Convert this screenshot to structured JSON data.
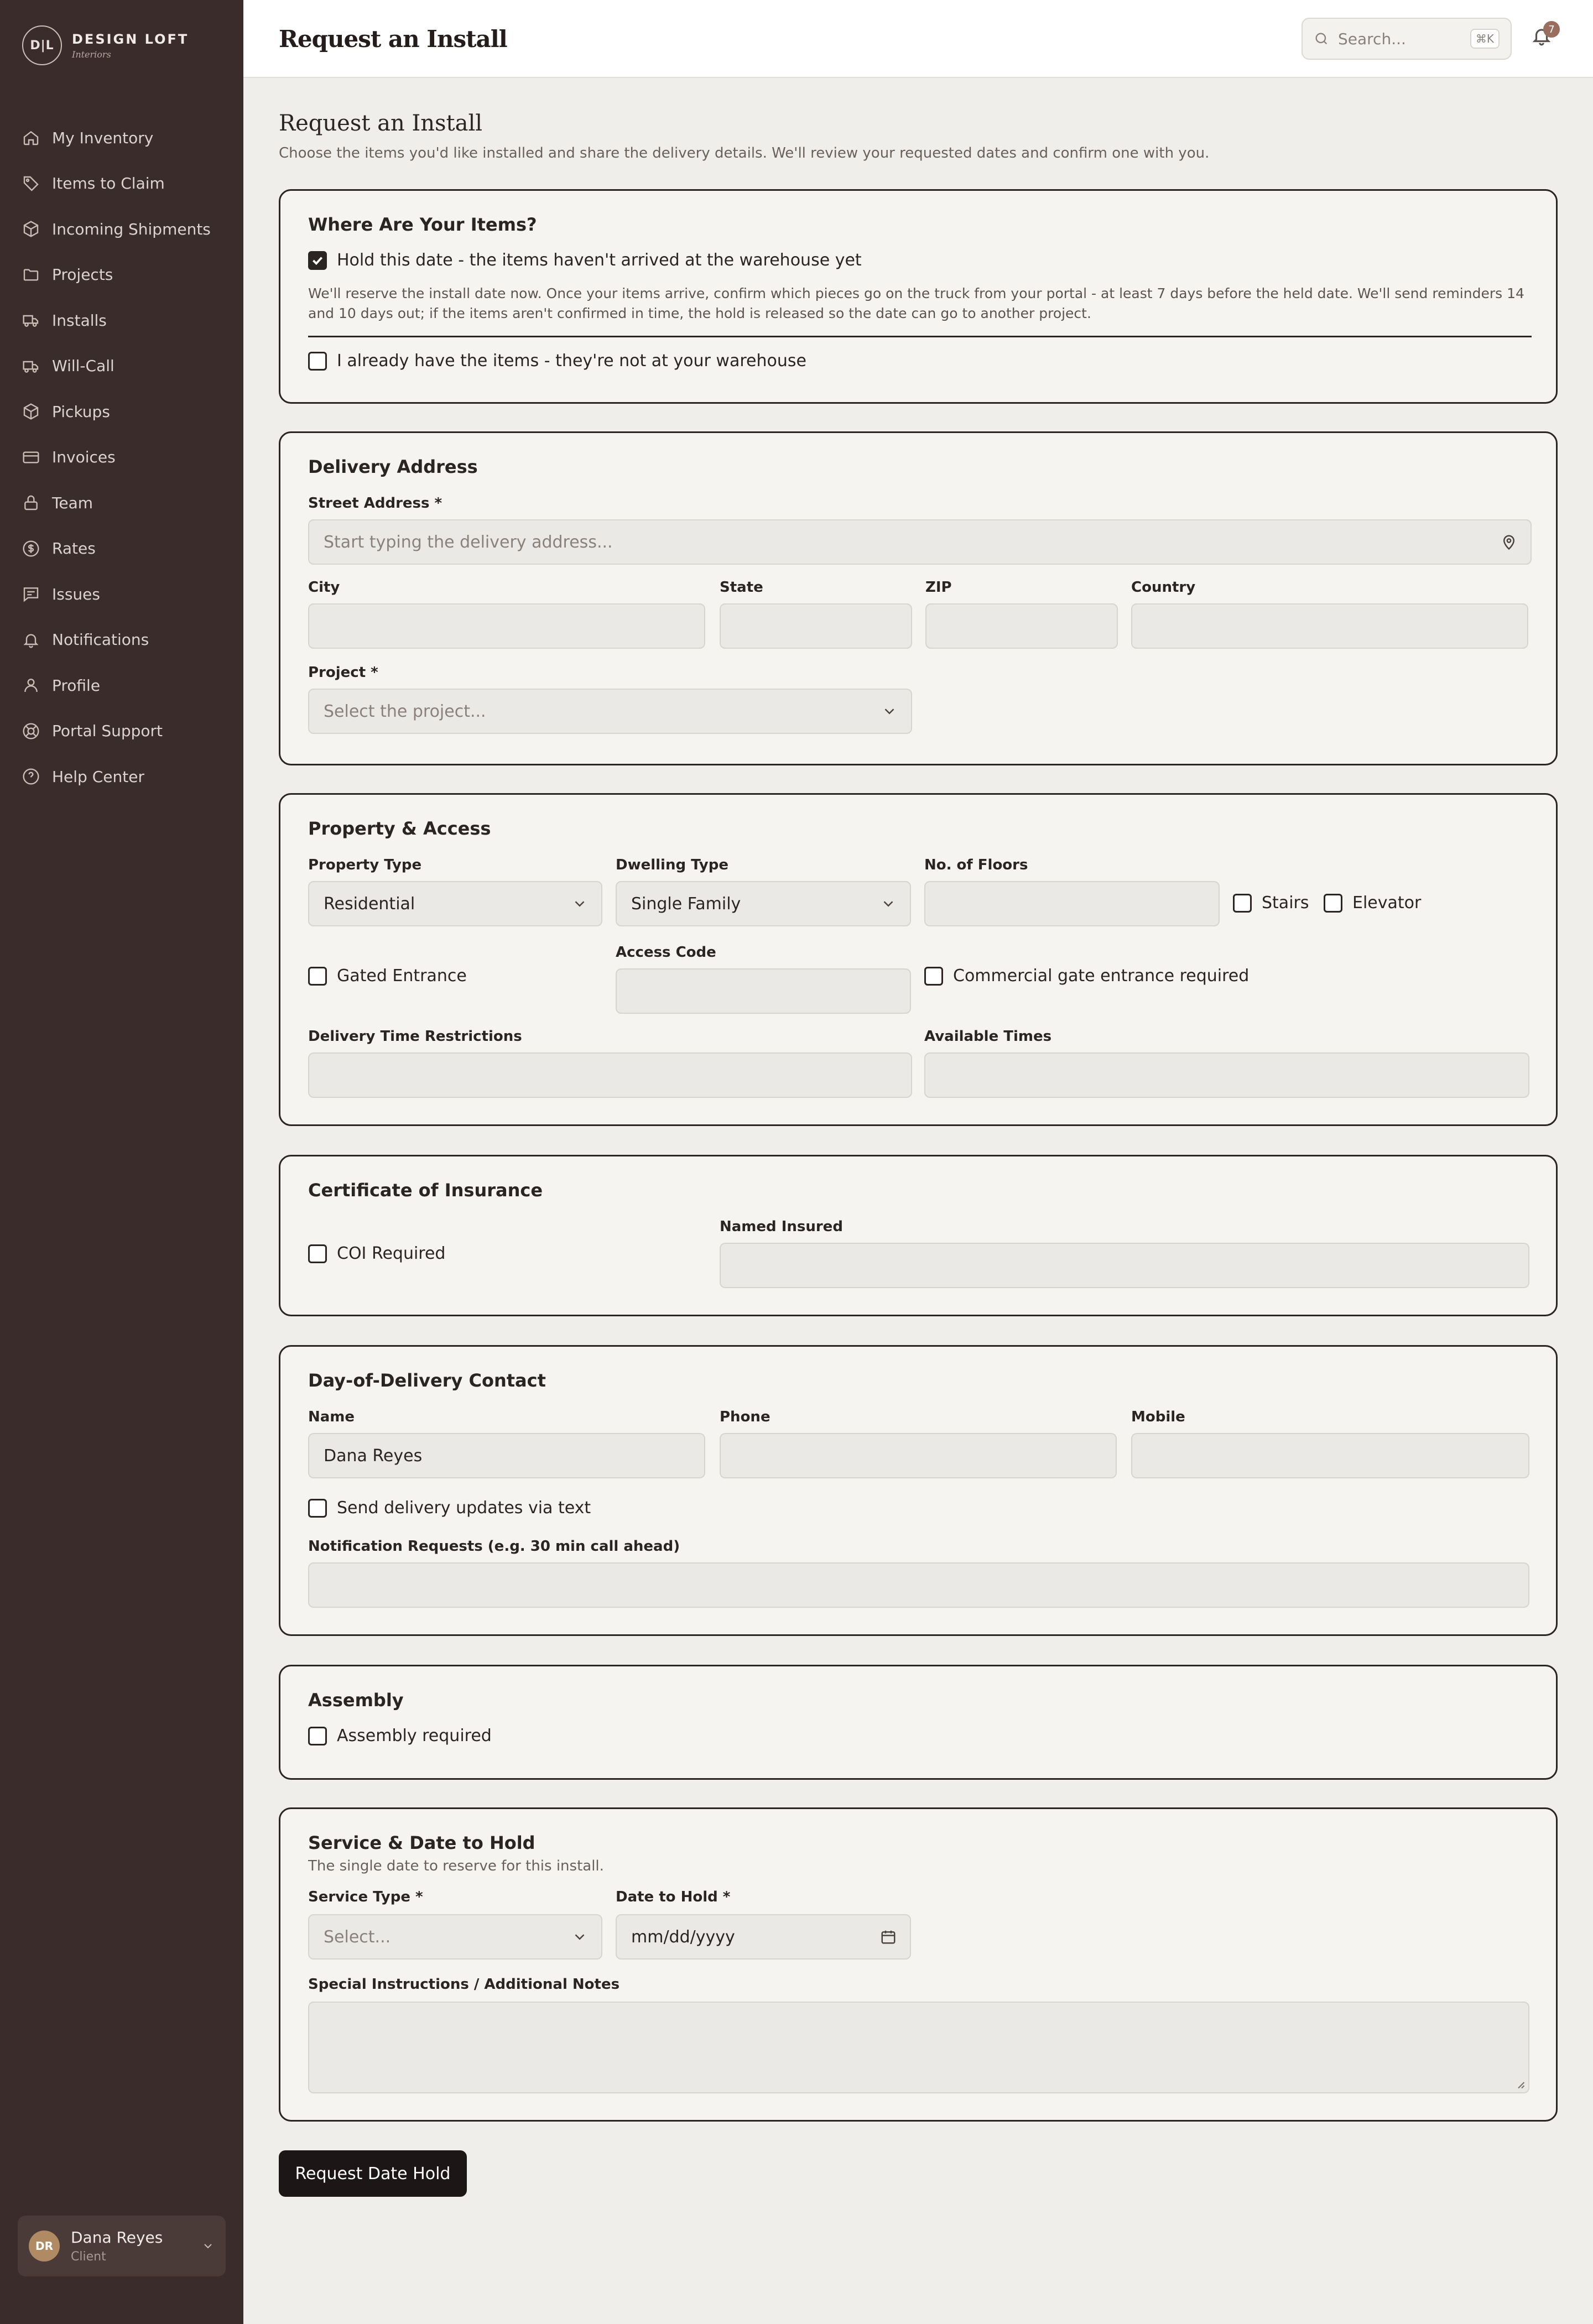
{
  "brand": {
    "monogram": "D|L",
    "name": "DESIGN LOFT",
    "script": "Interiors"
  },
  "sidebar": {
    "items": [
      {
        "label": "My Inventory",
        "icon": "home-icon"
      },
      {
        "label": "Items to Claim",
        "icon": "tag-icon"
      },
      {
        "label": "Incoming Shipments",
        "icon": "package-icon"
      },
      {
        "label": "Projects",
        "icon": "folder-icon"
      },
      {
        "label": "Installs",
        "icon": "truck-icon"
      },
      {
        "label": "Will-Call",
        "icon": "truck-icon"
      },
      {
        "label": "Pickups",
        "icon": "package-icon"
      },
      {
        "label": "Invoices",
        "icon": "credit-card-icon"
      },
      {
        "label": "Team",
        "icon": "lock-icon"
      },
      {
        "label": "Rates",
        "icon": "dollar-icon"
      },
      {
        "label": "Issues",
        "icon": "message-icon"
      },
      {
        "label": "Notifications",
        "icon": "bell-icon"
      },
      {
        "label": "Profile",
        "icon": "user-icon"
      },
      {
        "label": "Portal Support",
        "icon": "lifebuoy-icon"
      },
      {
        "label": "Help Center",
        "icon": "help-icon"
      }
    ],
    "user": {
      "initials": "DR",
      "name": "Dana Reyes",
      "role": "Client"
    }
  },
  "header": {
    "title": "Request an Install",
    "search_placeholder": "Search...",
    "search_shortcut": "⌘K",
    "notification_count": "7"
  },
  "page": {
    "title": "Request an Install",
    "subtitle": "Choose the items you'd like installed and share the delivery details. We'll review your requested dates and confirm one with you."
  },
  "items_section": {
    "title": "Where Are Your Items?",
    "hold_label": "Hold this date - the items haven't arrived at the warehouse yet",
    "hold_checked": true,
    "hold_help": "We'll reserve the install date now. Once your items arrive, confirm which pieces go on the truck from your portal - at least 7 days before the held date. We'll send reminders 14 and 10 days out; if the items aren't confirmed in time, the hold is released so the date can go to another project.",
    "have_items_label": "I already have the items - they're not at your warehouse",
    "have_items_checked": false
  },
  "delivery": {
    "title": "Delivery Address",
    "street_label": "Street Address *",
    "street_placeholder": "Start typing the delivery address...",
    "city_label": "City",
    "state_label": "State",
    "zip_label": "ZIP",
    "country_label": "Country",
    "project_label": "Project *",
    "project_placeholder": "Select the project..."
  },
  "property": {
    "title": "Property & Access",
    "property_type_label": "Property Type",
    "property_type_value": "Residential",
    "dwelling_type_label": "Dwelling Type",
    "dwelling_type_value": "Single Family",
    "floors_label": "No. of Floors",
    "stairs_label": "Stairs",
    "elevator_label": "Elevator",
    "gated_label": "Gated Entrance",
    "access_code_label": "Access Code",
    "commercial_gate_label": "Commercial gate entrance required",
    "time_restrictions_label": "Delivery Time Restrictions",
    "available_times_label": "Available Times"
  },
  "coi": {
    "title": "Certificate of Insurance",
    "coi_label": "COI Required",
    "named_insured_label": "Named Insured"
  },
  "contact": {
    "title": "Day-of-Delivery Contact",
    "name_label": "Name",
    "name_value": "Dana Reyes",
    "phone_label": "Phone",
    "mobile_label": "Mobile",
    "sms_label": "Send delivery updates via text",
    "notification_label": "Notification Requests (e.g. 30 min call ahead)"
  },
  "assembly": {
    "title": "Assembly",
    "assembly_label": "Assembly required"
  },
  "service": {
    "title": "Service & Date to Hold",
    "subtitle": "The single date to reserve for this install.",
    "service_type_label": "Service Type *",
    "service_type_placeholder": "Select...",
    "date_label": "Date to Hold *",
    "date_placeholder": "mm/dd/yyyy",
    "notes_label": "Special Instructions / Additional Notes"
  },
  "submit_label": "Request Date Hold"
}
